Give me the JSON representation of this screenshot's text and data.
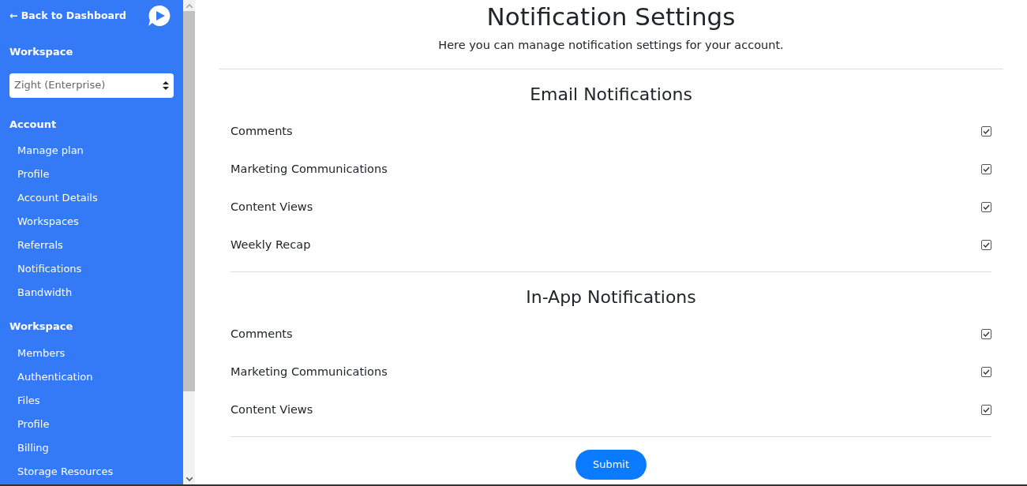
{
  "sidebar": {
    "back_link": "← Back to Dashboard",
    "workspace_heading": "Workspace",
    "workspace_select": {
      "value": "Zight (Enterprise)"
    },
    "groups": [
      {
        "heading": "Account",
        "items": [
          "Manage plan",
          "Profile",
          "Account Details",
          "Workspaces",
          "Referrals",
          "Notifications",
          "Bandwidth"
        ]
      },
      {
        "heading": "Workspace",
        "items": [
          "Members",
          "Authentication",
          "Files",
          "Profile",
          "Billing",
          "Storage Resources"
        ]
      }
    ]
  },
  "page": {
    "title": "Notification Settings",
    "subtitle": "Here you can manage notification settings for your account.",
    "sections": [
      {
        "title": "Email Notifications",
        "options": [
          {
            "label": "Comments",
            "checked": true
          },
          {
            "label": "Marketing Communications",
            "checked": true
          },
          {
            "label": "Content Views",
            "checked": true
          },
          {
            "label": "Weekly Recap",
            "checked": true
          }
        ]
      },
      {
        "title": "In-App Notifications",
        "options": [
          {
            "label": "Comments",
            "checked": true
          },
          {
            "label": "Marketing Communications",
            "checked": true
          },
          {
            "label": "Content Views",
            "checked": true
          }
        ]
      }
    ],
    "submit": "Submit"
  }
}
